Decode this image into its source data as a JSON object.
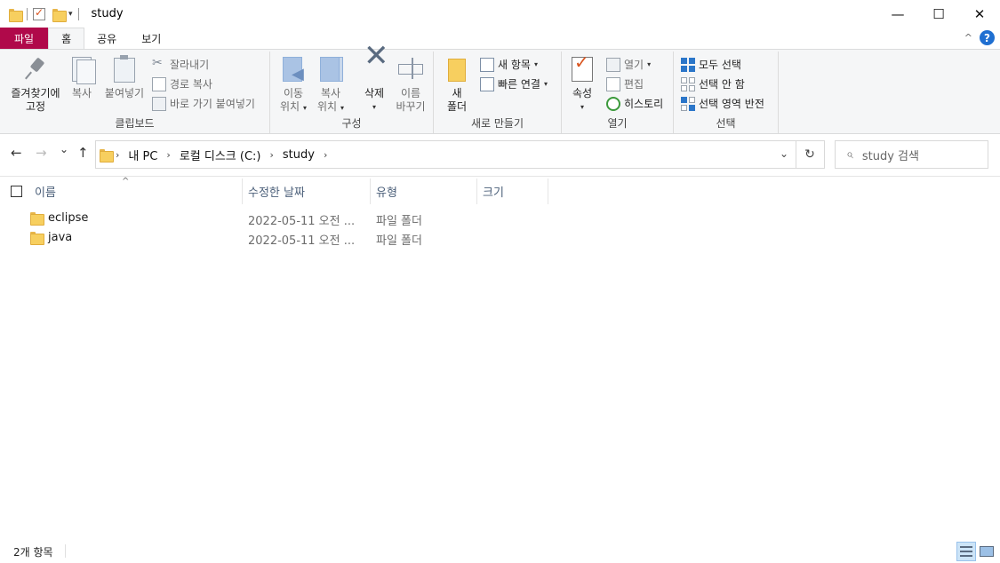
{
  "window": {
    "title": "study",
    "minimize_glyph": "—",
    "maximize_glyph": "☐",
    "close_glyph": "✕"
  },
  "ribbon_tabs": [
    {
      "label": "파일"
    },
    {
      "label": "홈"
    },
    {
      "label": "공유"
    },
    {
      "label": "보기"
    }
  ],
  "clipboard": {
    "pin_label": "즐겨찾기에\n고정",
    "pin_line1": "즐겨찾기에",
    "pin_line2": "고정",
    "copy_label": "복사",
    "paste_label": "붙여넣기",
    "cut_label": "잘라내기",
    "copy_path_label": "경로 복사",
    "paste_shortcut_label": "바로 가기 붙여넣기",
    "group_label": "클립보드"
  },
  "organize": {
    "move_line1": "이동",
    "move_line2": "위치",
    "copy_line1": "복사",
    "copy_line2": "위치",
    "delete_label": "삭제",
    "rename_line1": "이름",
    "rename_line2": "바꾸기",
    "group_label": "구성"
  },
  "new": {
    "new_item_label": "새 항목",
    "easy_access_label": "빠른 연결",
    "new_folder_line1": "새",
    "new_folder_line2": "폴더",
    "group_label": "새로 만들기"
  },
  "open": {
    "properties_label": "속성",
    "open_label": "열기",
    "edit_label": "편집",
    "history_label": "히스토리",
    "group_label": "열기"
  },
  "select": {
    "select_all_label": "모두 선택",
    "select_none_label": "선택 안 함",
    "invert_label": "선택 영역 반전",
    "group_label": "선택"
  },
  "navigation": {
    "back_glyph": "←",
    "forward_glyph": "→",
    "recent_glyph": "⌄",
    "up_glyph": "↑",
    "breadcrumb": [
      "내 PC",
      "로컬 디스크 (C:)",
      "study"
    ],
    "refresh_glyph": "↻",
    "search_placeholder": "study 검색"
  },
  "columns": {
    "name": "이름",
    "date": "수정한 날짜",
    "type": "유형",
    "size": "크기"
  },
  "files": [
    {
      "name": "eclipse",
      "date": "2022-05-11 오전 ...",
      "type": "파일 폴더",
      "size": ""
    },
    {
      "name": "java",
      "date": "2022-05-11 오전 ...",
      "type": "파일 폴더",
      "size": ""
    }
  ],
  "status": {
    "item_count": "2개 항목"
  },
  "colors": {
    "file_tab": "#b0094a",
    "accent_blue": "#2b76c9",
    "folder_yellow": "#f7cf5f"
  }
}
